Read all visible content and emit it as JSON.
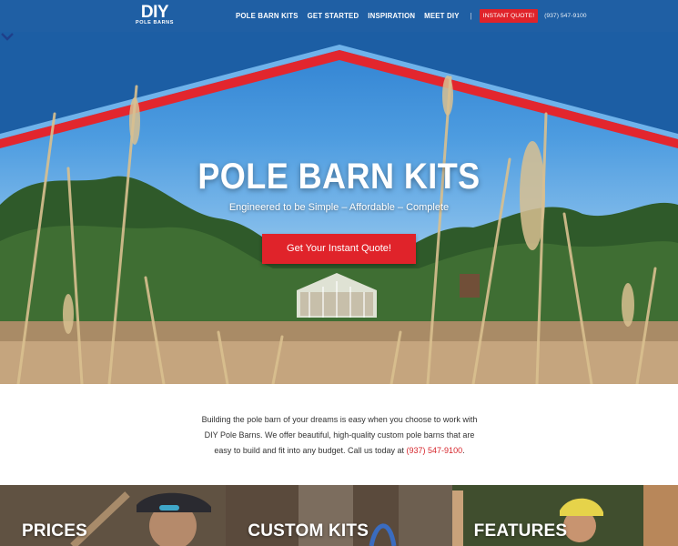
{
  "header": {
    "logo": {
      "main": "DIY",
      "sub": "POLE BARNS"
    },
    "nav": [
      {
        "label": "POLE BARN KITS"
      },
      {
        "label": "GET STARTED"
      },
      {
        "label": "INSPIRATION"
      },
      {
        "label": "MEET DIY"
      }
    ],
    "separator": "|",
    "quote_button": "INSTANT QUOTE!",
    "phone": "(937) 547-9100"
  },
  "hero": {
    "title": "POLE BARN KITS",
    "subtitle": "Engineered to be Simple – Affordable – Complete",
    "cta": "Get Your Instant Quote!",
    "scroll_icon": "chevron-down-icon"
  },
  "intro": {
    "text": "Building the pole barn of your dreams is easy when you choose to work with DIY Pole Barns. We offer beautiful, high-quality custom pole barns that are easy to build and fit into any budget. Call us today at ",
    "phone": "(937) 547-9100",
    "end": "."
  },
  "tiles": [
    {
      "label": "PRICES"
    },
    {
      "label": "CUSTOM KITS"
    },
    {
      "label": "FEATURES"
    }
  ],
  "colors": {
    "brand_blue": "#1f5fa4",
    "accent_red": "#e0232a",
    "text_dark": "#333333"
  }
}
